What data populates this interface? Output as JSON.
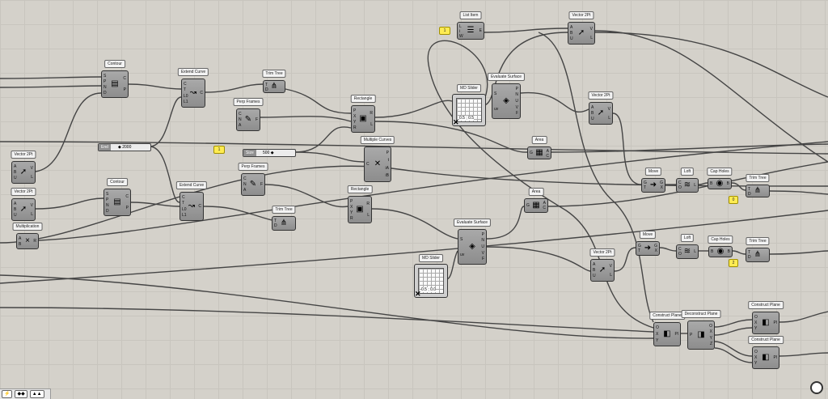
{
  "components": [
    {
      "id": "contour1",
      "title": "Contour",
      "inputs": [
        "S",
        "P",
        "N",
        "D"
      ],
      "outputs": [
        "C",
        "P"
      ],
      "icon": "contour-icon"
    },
    {
      "id": "extend1",
      "title": "Extend Curve",
      "inputs": [
        "C",
        "T",
        "L0",
        "L1"
      ],
      "outputs": [
        "C"
      ],
      "icon": "extend-curve-icon"
    },
    {
      "id": "trim1",
      "title": "Trim Tree",
      "inputs": [
        "T",
        "D"
      ],
      "outputs": [],
      "icon": "trim-tree-icon"
    },
    {
      "id": "perp1",
      "title": "Perp Frames",
      "inputs": [
        "C",
        "N",
        "A"
      ],
      "outputs": [
        "F"
      ],
      "icon": "perp-frames-icon"
    },
    {
      "id": "rect1",
      "title": "Rectangle",
      "inputs": [
        "P",
        "X",
        "Y",
        "R"
      ],
      "outputs": [
        "R",
        "L"
      ],
      "icon": "rectangle-icon"
    },
    {
      "id": "multiple",
      "title": "Multiple Curves",
      "inputs": [
        "C"
      ],
      "outputs": [
        "P",
        "t",
        "iA",
        "iB"
      ],
      "icon": "multiple-curves-icon"
    },
    {
      "id": "listitem",
      "title": "List Item",
      "inputs": [
        "L",
        "i",
        "W"
      ],
      "outputs": [
        "E"
      ],
      "icon": "list-item-icon"
    },
    {
      "id": "vec1",
      "title": "Vector 2Pt",
      "inputs": [
        "A",
        "B",
        "U"
      ],
      "outputs": [
        "V",
        "L"
      ],
      "icon": "vector-icon"
    },
    {
      "id": "evalsrf1",
      "title": "Evaluate Surface",
      "inputs": [
        "S",
        "uv"
      ],
      "outputs": [
        "P",
        "N",
        "U",
        "V",
        "F"
      ],
      "icon": "evaluate-surface-icon"
    },
    {
      "id": "area1",
      "title": "Area",
      "inputs": [
        "G"
      ],
      "outputs": [
        "A",
        "C"
      ],
      "icon": "area-icon"
    },
    {
      "id": "vec2",
      "title": "Vector 2Pt",
      "inputs": [
        "A",
        "B",
        "U"
      ],
      "outputs": [
        "V",
        "L"
      ],
      "icon": "vector-icon"
    },
    {
      "id": "move1",
      "title": "Move",
      "inputs": [
        "G",
        "T"
      ],
      "outputs": [
        "G",
        "X"
      ],
      "icon": "move-icon"
    },
    {
      "id": "loft1",
      "title": "Loft",
      "inputs": [
        "C",
        "O"
      ],
      "outputs": [
        "L"
      ],
      "icon": "loft-icon"
    },
    {
      "id": "cap1",
      "title": "Cap Holes",
      "inputs": [
        "B"
      ],
      "outputs": [
        "B"
      ],
      "icon": "cap-holes-icon"
    },
    {
      "id": "trim2",
      "title": "Trim Tree",
      "inputs": [
        "T",
        "D"
      ],
      "outputs": [],
      "icon": "trim-tree-icon"
    },
    {
      "id": "vecL1",
      "title": "Vector 2Pt",
      "inputs": [
        "A",
        "B",
        "U"
      ],
      "outputs": [
        "V",
        "L"
      ],
      "icon": "vector-icon"
    },
    {
      "id": "contour2",
      "title": "Contour",
      "inputs": [
        "S",
        "P",
        "N",
        "D"
      ],
      "outputs": [
        "C",
        "P"
      ],
      "icon": "contour-icon"
    },
    {
      "id": "extend2",
      "title": "Extend Curve",
      "inputs": [
        "C",
        "T",
        "L0",
        "L1"
      ],
      "outputs": [
        "C"
      ],
      "icon": "extend-curve-icon"
    },
    {
      "id": "perp2",
      "title": "Perp Frames",
      "inputs": [
        "C",
        "N",
        "A"
      ],
      "outputs": [
        "F"
      ],
      "icon": "perp-frames-icon"
    },
    {
      "id": "rect2",
      "title": "Rectangle",
      "inputs": [
        "P",
        "X",
        "Y",
        "R"
      ],
      "outputs": [
        "R",
        "L"
      ],
      "icon": "rectangle-icon"
    },
    {
      "id": "vecL2",
      "title": "Vector 2Pt",
      "inputs": [
        "A",
        "B",
        "U"
      ],
      "outputs": [
        "V",
        "L"
      ],
      "icon": "vector-icon"
    },
    {
      "id": "trim3",
      "title": "Trim Tree",
      "inputs": [
        "T",
        "D"
      ],
      "outputs": [],
      "icon": "trim-tree-icon"
    },
    {
      "id": "mult",
      "title": "Multiplication",
      "inputs": [
        "A",
        "B"
      ],
      "outputs": [
        "R"
      ],
      "icon": "multiplication-icon"
    },
    {
      "id": "area2",
      "title": "Area",
      "inputs": [
        "G"
      ],
      "outputs": [
        "A",
        "C"
      ],
      "icon": "area-icon"
    },
    {
      "id": "evalsrf2",
      "title": "Evaluate Surface",
      "inputs": [
        "S",
        "uv"
      ],
      "outputs": [
        "P",
        "N",
        "U",
        "V",
        "F"
      ],
      "icon": "evaluate-surface-icon"
    },
    {
      "id": "move2",
      "title": "Move",
      "inputs": [
        "G",
        "T"
      ],
      "outputs": [
        "G",
        "X"
      ],
      "icon": "move-icon"
    },
    {
      "id": "loft2",
      "title": "Loft",
      "inputs": [
        "C",
        "O"
      ],
      "outputs": [
        "L"
      ],
      "icon": "loft-icon"
    },
    {
      "id": "cap2",
      "title": "Cap Holes",
      "inputs": [
        "B"
      ],
      "outputs": [
        "B"
      ],
      "icon": "cap-holes-icon"
    },
    {
      "id": "trim4",
      "title": "Trim Tree",
      "inputs": [
        "T",
        "D"
      ],
      "outputs": [],
      "icon": "trim-tree-icon"
    },
    {
      "id": "vec3",
      "title": "Vector 2Pt",
      "inputs": [
        "A",
        "B",
        "U"
      ],
      "outputs": [
        "V",
        "L"
      ],
      "icon": "vector-icon"
    },
    {
      "id": "cplane1",
      "title": "Construct Plane",
      "inputs": [
        "O",
        "X",
        "Y"
      ],
      "outputs": [
        "Pl"
      ],
      "icon": "construct-plane-icon"
    },
    {
      "id": "dplane",
      "title": "Deconstruct Plane",
      "inputs": [
        "P"
      ],
      "outputs": [
        "O",
        "X",
        "Y",
        "Z"
      ],
      "icon": "deconstruct-plane-icon"
    },
    {
      "id": "cplane2",
      "title": "Construct Plane",
      "inputs": [
        "O",
        "X",
        "Y"
      ],
      "outputs": [
        "Pl"
      ],
      "icon": "construct-plane-icon"
    },
    {
      "id": "cplane3",
      "title": "Construct Plane",
      "inputs": [
        "O",
        "X",
        "Y"
      ],
      "outputs": [
        "Pl"
      ],
      "icon": "construct-plane-icon"
    }
  ],
  "sliders": [
    {
      "id": "slider_end",
      "label": "End",
      "value": "◆ 2000"
    },
    {
      "id": "slider_size",
      "label": "Size",
      "value": "500 ◆"
    }
  ],
  "panels": [
    {
      "id": "panel_li",
      "text": "1"
    },
    {
      "id": "panel_perp",
      "text": "1"
    },
    {
      "id": "panel_trim1",
      "text": "0"
    },
    {
      "id": "panel_trim2",
      "text": "2"
    }
  ],
  "md_sliders": [
    {
      "id": "md1",
      "title": "MD Slider",
      "value": "0.5 ; 0.5"
    },
    {
      "id": "md2",
      "title": "MD Slider",
      "value": "0.5 ; 0.0"
    }
  ],
  "statusbar": {
    "items": [
      "⚡",
      "◆◆",
      "▲▲"
    ]
  }
}
